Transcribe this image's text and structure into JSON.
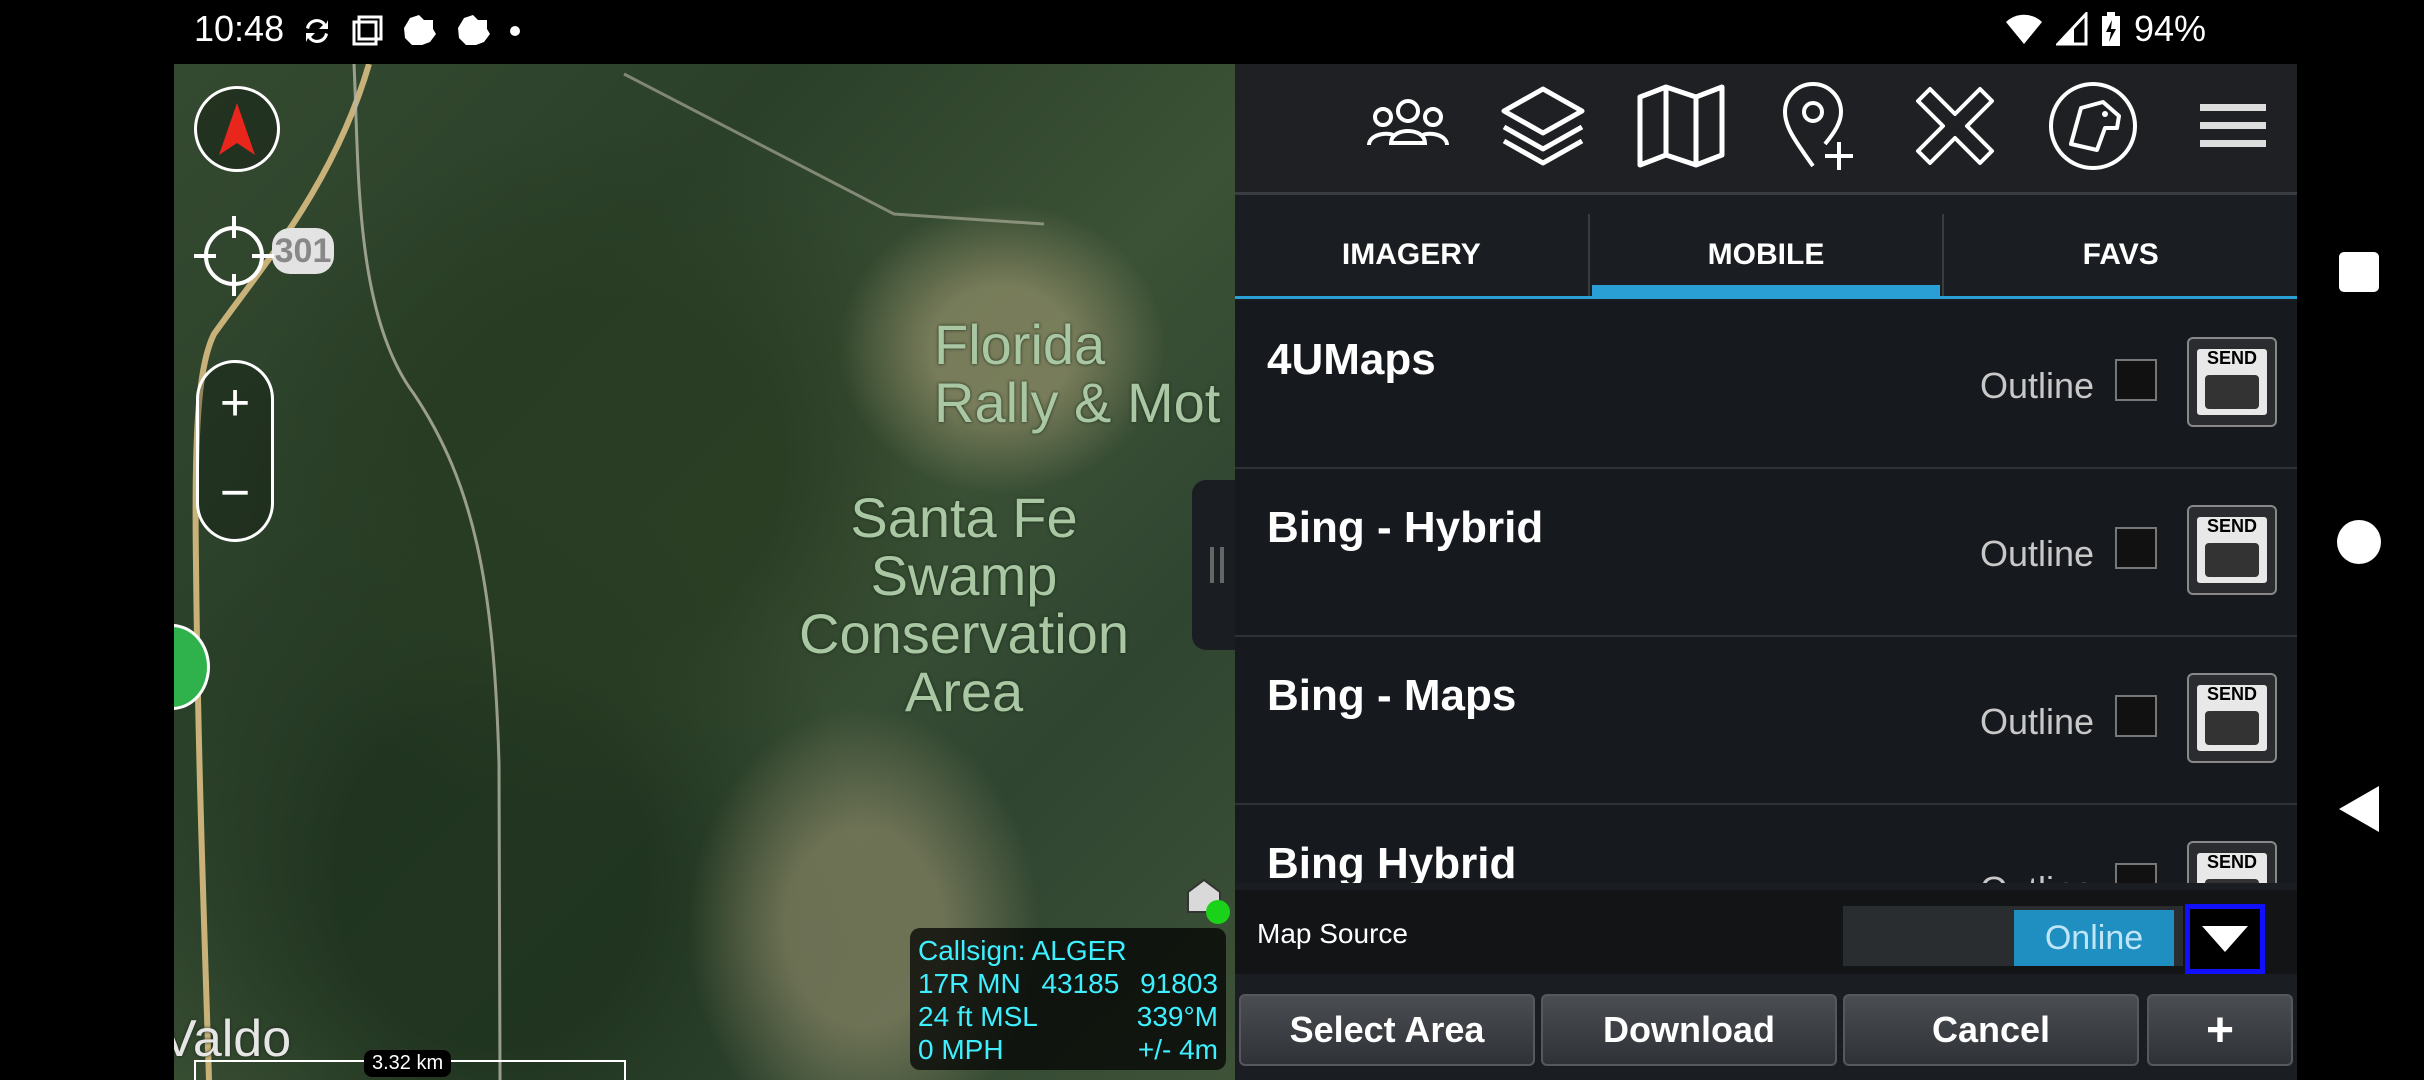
{
  "status": {
    "time": "10:48",
    "battery": "94%",
    "icons_left": [
      "sync-icon",
      "screenshot-icon",
      "notification-icon",
      "notification-icon",
      "dot-icon"
    ],
    "icons_right": [
      "wifi-icon",
      "signal-icon",
      "battery-icon"
    ]
  },
  "map": {
    "labels": {
      "florida": "Florida\nRally & Mot",
      "swamp": "Santa Fe\nSwamp\nConservation\nArea",
      "waldo": "Valdo",
      "route": "301"
    },
    "scale": "3.32 km",
    "info": {
      "callsign": "Callsign: ALGER",
      "grid_zone": "17R  MN",
      "easting": "43185",
      "northing": "91803",
      "altitude": "24 ft MSL",
      "heading": "339°M",
      "speed": "0 MPH",
      "accuracy": "+/- 4m"
    },
    "zoom_in": "+",
    "zoom_out": "−"
  },
  "toolbar": {
    "icons": [
      "contacts-icon",
      "layers-icon",
      "map-icon",
      "add-marker-icon",
      "close-icon",
      "dog-icon",
      "menu-icon"
    ]
  },
  "tabs": [
    {
      "label": "IMAGERY",
      "active": false
    },
    {
      "label": "MOBILE",
      "active": true
    },
    {
      "label": "FAVS",
      "active": false
    }
  ],
  "map_list": [
    {
      "name": "4UMaps",
      "outline_label": "Outline",
      "send_label": "SEND"
    },
    {
      "name": "Bing - Hybrid",
      "outline_label": "Outline",
      "send_label": "SEND"
    },
    {
      "name": "Bing - Maps",
      "outline_label": "Outline",
      "send_label": "SEND"
    },
    {
      "name": "Bing Hybrid",
      "outline_label": "Outline",
      "send_label": "SEND"
    }
  ],
  "map_source": {
    "label": "Map Source",
    "value": "Online"
  },
  "actions": {
    "select_area": "Select Area",
    "download": "Download",
    "cancel": "Cancel",
    "add": "+"
  }
}
